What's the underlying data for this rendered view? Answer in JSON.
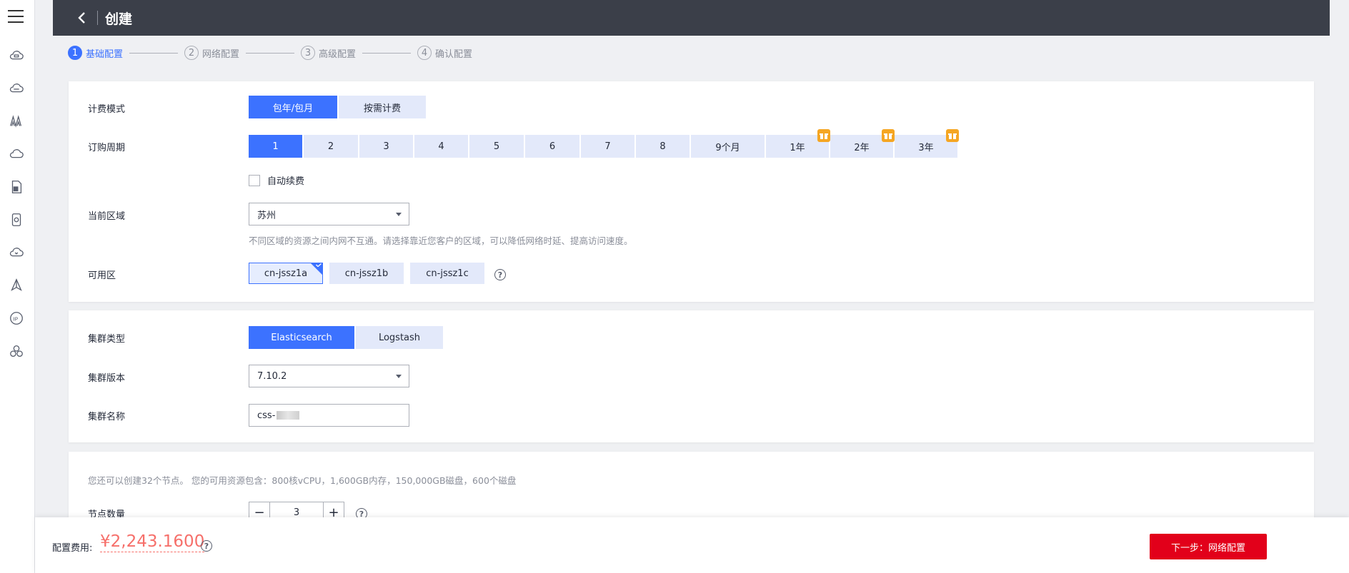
{
  "header": {
    "title": "创建"
  },
  "steps": [
    {
      "num": "1",
      "label": "基础配置"
    },
    {
      "num": "2",
      "label": "网络配置"
    },
    {
      "num": "3",
      "label": "高级配置"
    },
    {
      "num": "4",
      "label": "确认配置"
    }
  ],
  "billing": {
    "label": "计费模式",
    "options": [
      "包年/包月",
      "按需计费"
    ],
    "selected": "包年/包月"
  },
  "period": {
    "label": "订购周期",
    "options": [
      "1",
      "2",
      "3",
      "4",
      "5",
      "6",
      "7",
      "8",
      "9个月",
      "1年",
      "2年",
      "3年"
    ],
    "selected": "1",
    "gift_icon": "gift-icon"
  },
  "auto_renew": {
    "label": "自动续费",
    "checked": false
  },
  "region": {
    "label": "当前区域",
    "value": "苏州",
    "hint": "不同区域的资源之间内网不互通。请选择靠近您客户的区域，可以降低网络时延、提高访问速度。"
  },
  "az": {
    "label": "可用区",
    "options": [
      "cn-jssz1a",
      "cn-jssz1b",
      "cn-jssz1c"
    ],
    "selected": "cn-jssz1a"
  },
  "cluster_type": {
    "label": "集群类型",
    "options": [
      "Elasticsearch",
      "Logstash"
    ],
    "selected": "Elasticsearch"
  },
  "cluster_version": {
    "label": "集群版本",
    "value": "7.10.2"
  },
  "cluster_name": {
    "label": "集群名称",
    "value": "css-"
  },
  "nodes": {
    "hint": "您还可以创建32个节点。 您的可用资源包含：800核vCPU，1,600GB内存，150,000GB磁盘，600个磁盘",
    "label": "节点数量",
    "value": "3",
    "minus": "−",
    "plus": "+"
  },
  "footer": {
    "cost_label": "配置费用:",
    "cost": "¥2,243.1600",
    "next_label": "下一步：网络配置"
  },
  "help_glyph": "?",
  "colors": {
    "accent": "#3c72ff",
    "header_bg": "#3b3f49",
    "primary_btn": "#e2001a",
    "price": "#f66f6a",
    "gift": "#f5a623"
  },
  "sidebar_icons": [
    "menu-icon",
    "cloud-server-icon",
    "cloud-ecs-icon",
    "network-icon",
    "cloud-icon",
    "document-icon",
    "storage-icon",
    "cloud-sync-icon",
    "deploy-icon",
    "ip-icon",
    "cluster-icon"
  ]
}
